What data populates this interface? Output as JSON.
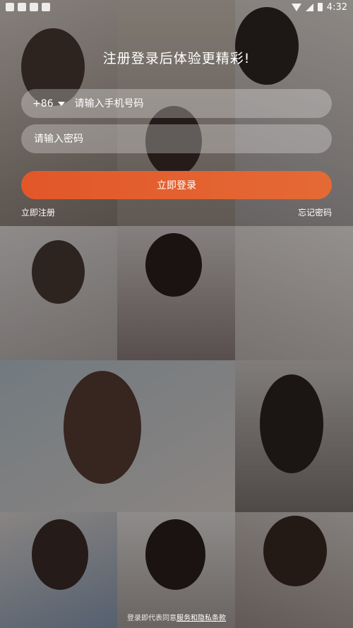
{
  "status_bar": {
    "time": "4:32"
  },
  "title": "注册登录后体验更精彩!",
  "phone": {
    "country_code": "+86",
    "placeholder": "请输入手机号码"
  },
  "password": {
    "placeholder": "请输入密码"
  },
  "login_button": "立即登录",
  "register_link": "立即注册",
  "forgot_link": "忘记密码",
  "footer": {
    "agree_text": "登录即代表同意",
    "terms_link": "服务和隐私条款"
  },
  "colors": {
    "accent": "#e2572a",
    "background": "#1b1b1f"
  }
}
